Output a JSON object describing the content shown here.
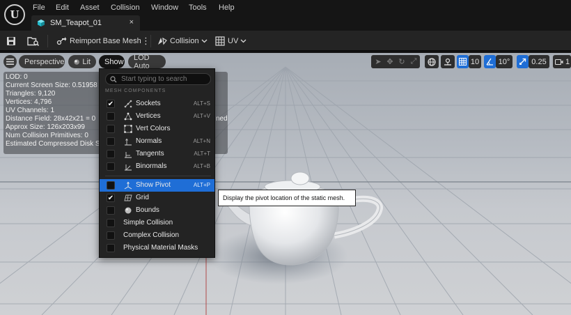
{
  "menubar": {
    "items": [
      "File",
      "Edit",
      "Asset",
      "Collision",
      "Window",
      "Tools",
      "Help"
    ]
  },
  "asset_tab": {
    "name": "SM_Teapot_01",
    "close": "×"
  },
  "toolbar": {
    "reimport_label": "Reimport Base Mesh",
    "more": "⋮",
    "collision_label": "Collision",
    "uv_label": "UV"
  },
  "viewport": {
    "menu_icon": "hamburger-icon",
    "perspective_label": "Perspective",
    "lit_label": "Lit",
    "show_label": "Show",
    "lod_label": "LOD Auto",
    "grid_snap_value": "10",
    "angle_snap_value": "10°",
    "scale_snap_value": "0.25",
    "camera_speed_value": "1"
  },
  "stats": {
    "lines": [
      "LOD: 0",
      "Current Screen Size: 0.51958",
      "Triangles: 9,120",
      "Vertices: 4,796",
      "UV Channels: 1",
      "Distance Field: 28x42x21 = 0",
      "Approx Size: 126x203x99",
      "Num Collision Primitives: 0",
      "Estimated Compressed Disk S"
    ],
    "overflow_text": "ned"
  },
  "show_menu": {
    "search_placeholder": "Start typing to search",
    "section_label": "MESH COMPONENTS",
    "items": [
      {
        "label": "Sockets",
        "shortcut": "ALT+S",
        "checked": true,
        "icon": "socket-icon"
      },
      {
        "label": "Vertices",
        "shortcut": "ALT+V",
        "checked": false,
        "icon": "vertices-icon"
      },
      {
        "label": "Vert Colors",
        "shortcut": "",
        "checked": false,
        "icon": "vert-colors-icon"
      },
      {
        "label": "Normals",
        "shortcut": "ALT+N",
        "checked": false,
        "icon": "normals-icon"
      },
      {
        "label": "Tangents",
        "shortcut": "ALT+T",
        "checked": false,
        "icon": "tangents-icon"
      },
      {
        "label": "Binormals",
        "shortcut": "ALT+B",
        "checked": false,
        "icon": "binormals-icon"
      },
      {
        "label": "Show Pivot",
        "shortcut": "ALT+P",
        "checked": false,
        "icon": "pivot-icon"
      },
      {
        "label": "Grid",
        "shortcut": "",
        "checked": true,
        "icon": "grid-icon"
      },
      {
        "label": "Bounds",
        "shortcut": "",
        "checked": false,
        "icon": "bounds-icon"
      },
      {
        "label": "Simple Collision",
        "shortcut": "",
        "checked": false
      },
      {
        "label": "Complex Collision",
        "shortcut": "",
        "checked": false
      },
      {
        "label": "Physical Material Masks",
        "shortcut": "",
        "checked": false
      }
    ],
    "check_glyph": "✔"
  },
  "tooltip": {
    "text": "Display the pivot location of the static mesh."
  },
  "colors": {
    "accent": "#1f6ed6",
    "menu_bg": "#232323",
    "toolbar_bg": "#242424"
  }
}
